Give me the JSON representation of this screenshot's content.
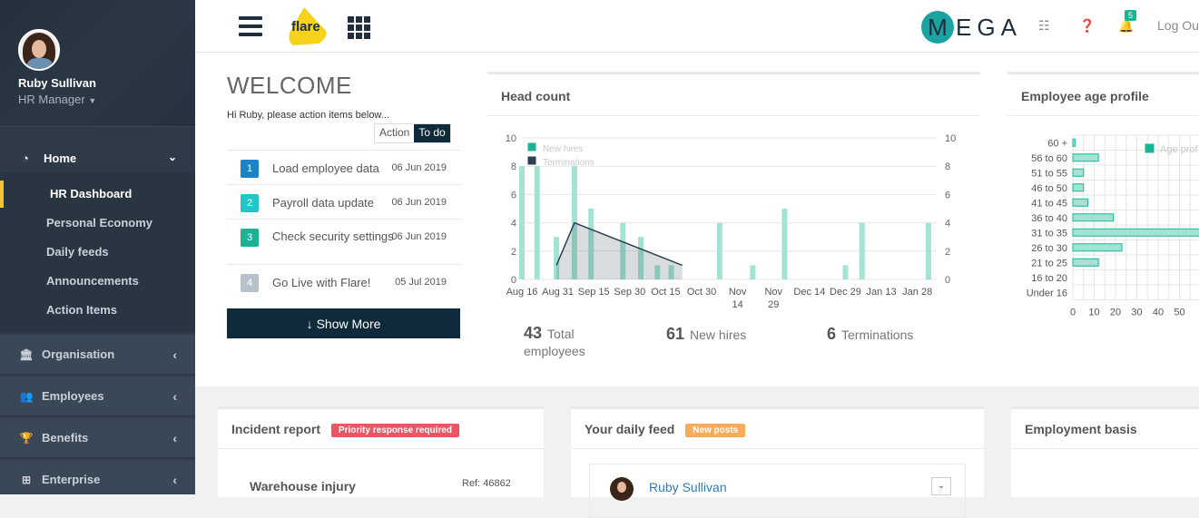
{
  "user": {
    "name": "Ruby Sullivan",
    "role": "HR Manager"
  },
  "sidebar": {
    "home": "Home",
    "sub": [
      "HR Dashboard",
      "Personal Economy",
      "Daily feeds",
      "Announcements",
      "Action Items"
    ],
    "main": [
      "Organisation",
      "Employees",
      "Benefits",
      "Enterprise"
    ]
  },
  "topbar": {
    "brand": "flare",
    "mega_m": "M",
    "mega_rest": "EGA",
    "notifications": "5",
    "logout": "Log Ou"
  },
  "welcome": {
    "title": "WELCOME",
    "subtitle": "Hi Ruby, please action items below...",
    "toggle": [
      "Action",
      "To do"
    ],
    "tasks": [
      {
        "n": "1",
        "label": "Load employee data",
        "date": "06 Jun 2019",
        "color": "#1c84c6"
      },
      {
        "n": "2",
        "label": "Payroll data update",
        "date": "06 Jun 2019",
        "color": "#23c6c8"
      },
      {
        "n": "3",
        "label": "Check security settings",
        "date": "06 Jun 2019",
        "color": "#1ab394"
      },
      {
        "n": "4",
        "label": "Go Live with Flare!",
        "date": "05 Jul 2019",
        "color": "#b7c1cb"
      }
    ],
    "show_more": "Show More"
  },
  "headcount": {
    "title": "Head count",
    "stats": [
      {
        "value": "43",
        "label": "Total employees"
      },
      {
        "value": "61",
        "label": "New hires"
      },
      {
        "value": "6",
        "label": "Terminations"
      }
    ]
  },
  "age_profile": {
    "title": "Employee age profile",
    "legend": "Age prof"
  },
  "bottom": {
    "incident": {
      "title": "Incident report",
      "badge": "Priority response required",
      "item": "Warehouse injury",
      "ref": "Ref: 46862"
    },
    "feed": {
      "title": "Your daily feed",
      "badge": "New posts",
      "author": "Ruby Sullivan"
    },
    "employment": {
      "title": "Employment basis"
    }
  },
  "chart_data": [
    {
      "type": "bar",
      "title": "Head count",
      "x": [
        "Aug 16",
        "Aug 31",
        "Sep 15",
        "Sep 30",
        "Oct 15",
        "Oct 30",
        "Nov 14",
        "Nov 29",
        "Dec 14",
        "Dec 29",
        "Jan 13",
        "Jan 28"
      ],
      "ylim": [
        0,
        10
      ],
      "yticks": [
        0,
        2,
        4,
        6,
        8,
        10
      ],
      "series": [
        {
          "name": "New hires",
          "type": "bar",
          "color": "#a3e3d3",
          "points": [
            [
              0.0,
              8
            ],
            [
              1.1,
              8
            ],
            [
              2.5,
              3
            ],
            [
              3.8,
              8
            ],
            [
              5.0,
              5
            ],
            [
              7.3,
              4
            ],
            [
              8.6,
              3
            ],
            [
              9.8,
              1
            ],
            [
              10.8,
              1
            ],
            [
              14.3,
              4
            ],
            [
              16.7,
              1
            ],
            [
              19.0,
              5
            ],
            [
              23.4,
              1
            ],
            [
              24.6,
              4
            ],
            [
              29.4,
              4
            ]
          ]
        },
        {
          "name": "Terminations",
          "type": "area",
          "color": "#2f4050",
          "points": [
            [
              2.5,
              1
            ],
            [
              3.8,
              4
            ],
            [
              11.6,
              1
            ]
          ]
        }
      ],
      "legend": "top-left"
    },
    {
      "type": "bar",
      "orientation": "horizontal",
      "title": "Employee age profile",
      "categories": [
        "60 +",
        "56 to 60",
        "51 to 55",
        "46 to 50",
        "41 to 45",
        "36 to 40",
        "31 to 35",
        "26 to 30",
        "21 to 25",
        "16 to 20",
        "Under 16"
      ],
      "values": [
        1,
        12,
        5,
        5,
        7,
        19,
        80,
        23,
        12,
        0,
        0
      ],
      "xticks": [
        0,
        10,
        20,
        30,
        40,
        50
      ],
      "series_name": "Age prof",
      "color": "#1ab394"
    }
  ]
}
